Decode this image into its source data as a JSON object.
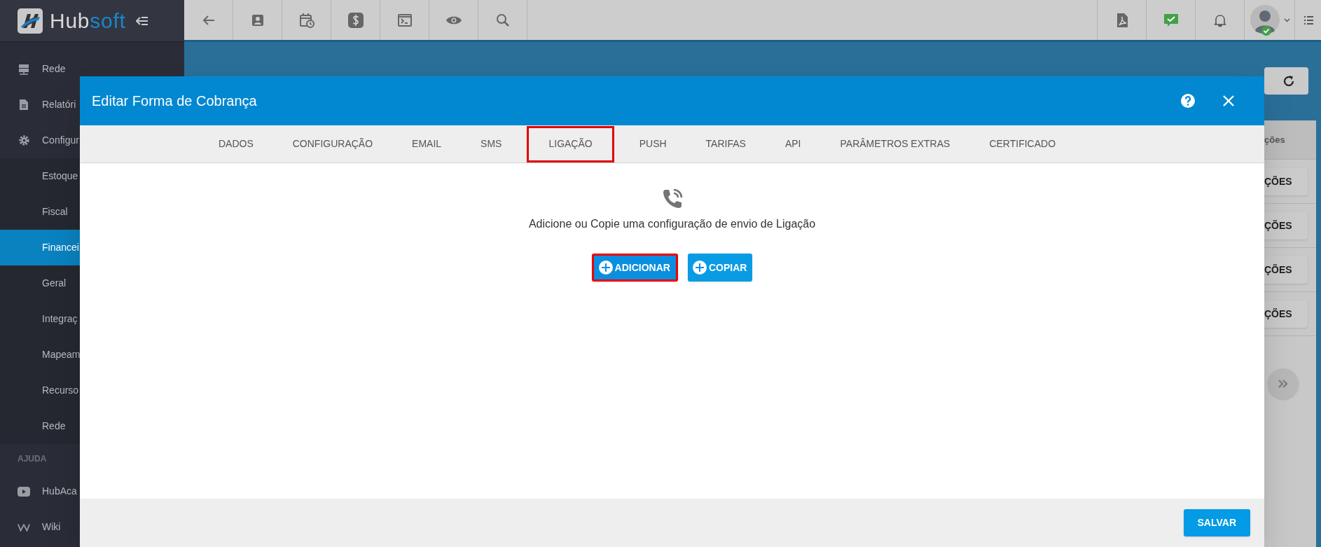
{
  "sidebar": {
    "brand": [
      "Hub",
      "soft"
    ],
    "items": [
      {
        "label": "Rede",
        "selected": false
      },
      {
        "label": "Relatóri",
        "selected": false
      },
      {
        "label": "Configur",
        "selected": false,
        "children": [
          {
            "label": "Estoque",
            "selected": false
          },
          {
            "label": "Fiscal",
            "selected": false
          },
          {
            "label": "Financei",
            "selected": true
          },
          {
            "label": "Geral",
            "selected": false
          },
          {
            "label": "Integraç",
            "selected": false
          },
          {
            "label": "Mapeam",
            "selected": false
          },
          {
            "label": "Recurso",
            "selected": false
          },
          {
            "label": "Rede",
            "selected": false
          }
        ]
      }
    ],
    "help_section": {
      "title": "AJUDA",
      "items": [
        {
          "label": "HubAca",
          "selected": false
        },
        {
          "label": "Wiki",
          "selected": false
        }
      ]
    }
  },
  "background_panel": {
    "header": "ções",
    "row_buttons": [
      "ÇÕES",
      "ÇÕES",
      "ÇÕES",
      "ÇÕES"
    ]
  },
  "modal": {
    "title": "Editar Forma de Cobrança",
    "tabs": [
      {
        "label": "DADOS",
        "selected": false
      },
      {
        "label": "CONFIGURAÇÃO",
        "selected": false
      },
      {
        "label": "EMAIL",
        "selected": false
      },
      {
        "label": "SMS",
        "selected": false
      },
      {
        "label": "LIGAÇÃO",
        "selected": true
      },
      {
        "label": "PUSH",
        "selected": false
      },
      {
        "label": "TARIFAS",
        "selected": false
      },
      {
        "label": "API",
        "selected": false
      },
      {
        "label": "PARÂMETROS EXTRAS",
        "selected": false
      },
      {
        "label": "CERTIFICADO",
        "selected": false
      }
    ],
    "message": "Adicione ou Copie uma configuração de envio de Ligação",
    "actions": [
      {
        "label": "ADICIONAR",
        "highlighted": true
      },
      {
        "label": "COPIAR",
        "highlighted": false
      }
    ],
    "save_button": "SALVAR"
  }
}
